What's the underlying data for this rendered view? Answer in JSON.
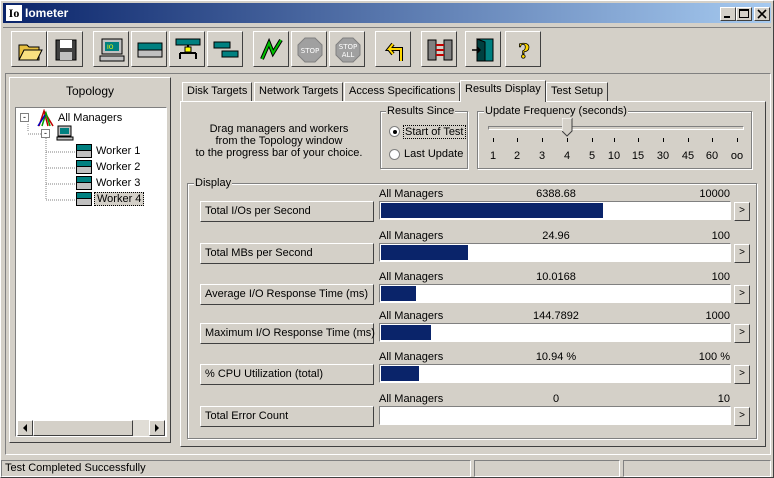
{
  "window": {
    "title": "Iometer",
    "app_icon_text": "Io"
  },
  "toolbar": {
    "icons": [
      "open-icon",
      "save-icon",
      "start-new-manager-icon",
      "start-disk-worker-icon",
      "start-network-worker-icon",
      "duplicate-worker-icon",
      "start-tests-icon",
      "stop-icon",
      "stop-all-icon",
      "reset-workers-icon",
      "disconnect-all-icon",
      "exit-icon",
      "about-icon"
    ],
    "stop_label": "STOP",
    "stop_all_label": "STOP",
    "stop_all_sub": "ALL"
  },
  "topology": {
    "title": "Topology",
    "root": "All Managers",
    "workers": [
      "Worker 1",
      "Worker 2",
      "Worker 3",
      "Worker 4"
    ],
    "selected": "Worker 4"
  },
  "tabs": [
    "Disk Targets",
    "Network Targets",
    "Access Specifications",
    "Results Display",
    "Test Setup"
  ],
  "active_tab": "Results Display",
  "instructions": "Drag managers and workers\nfrom the Topology window\nto the progress bar of your choice.",
  "results_since": {
    "title": "Results Since",
    "options": [
      "Start of Test",
      "Last Update"
    ],
    "selected": "Start of Test"
  },
  "update_frequency": {
    "title": "Update Frequency (seconds)",
    "ticks": [
      "1",
      "2",
      "3",
      "4",
      "5",
      "10",
      "15",
      "30",
      "45",
      "60",
      "oo"
    ],
    "selected": "4"
  },
  "display": {
    "title": "Display",
    "rows": [
      {
        "button": "Total I/Os per Second",
        "source": "All Managers",
        "value": "6388.68",
        "max": "10000",
        "fraction": 0.639
      },
      {
        "button": "Total MBs per Second",
        "source": "All Managers",
        "value": "24.96",
        "max": "100",
        "fraction": 0.2496
      },
      {
        "button": "Average I/O Response Time (ms)",
        "source": "All Managers",
        "value": "10.0168",
        "max": "100",
        "fraction": 0.1
      },
      {
        "button": "Maximum I/O Response Time (ms)",
        "source": "All Managers",
        "value": "144.7892",
        "max": "1000",
        "fraction": 0.145
      },
      {
        "button": "% CPU Utilization (total)",
        "source": "All Managers",
        "value": "10.94 %",
        "max": "100 %",
        "fraction": 0.109
      },
      {
        "button": "Total Error Count",
        "source": "All Managers",
        "value": "0",
        "max": "10",
        "fraction": 0
      }
    ],
    "arrow": ">"
  },
  "status_bar": {
    "text": "Test Completed Successfully"
  },
  "colors": {
    "title_bar": "#0a246a",
    "bar_fill": "#0a246a",
    "face": "#d4d0c8"
  }
}
